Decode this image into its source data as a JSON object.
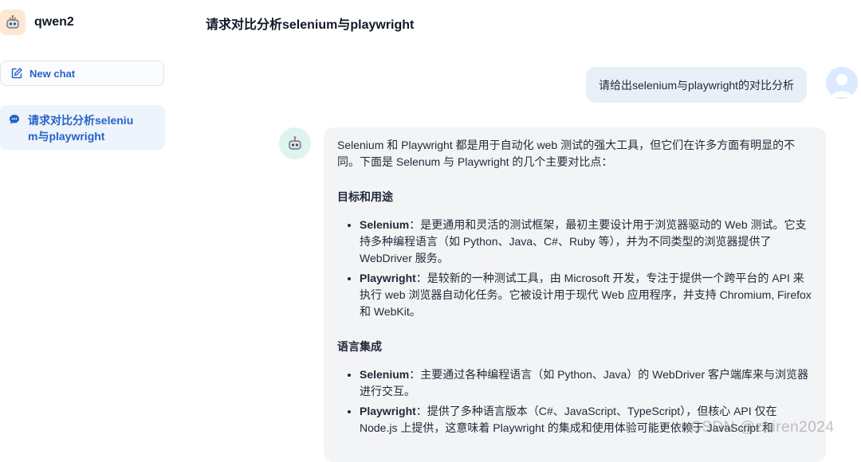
{
  "sidebar": {
    "brand_name": "qwen2",
    "new_chat_label": "New chat",
    "conversations": [
      {
        "label": "请求对比分析selenium与playwright"
      }
    ]
  },
  "header": {
    "title": "请求对比分析selenium与playwright"
  },
  "messages": {
    "user": {
      "text": "请给出selenium与playwright的对比分析"
    },
    "assistant": {
      "intro": "Selenium 和 Playwright 都是用于自动化 web 测试的强大工具，但它们在许多方面有明显的不同。下面是 Selenum 与 Playwright 的几个主要对比点：",
      "sections": [
        {
          "heading": "目标和用途",
          "items": [
            {
              "term": "Selenium",
              "text": "：是更通用和灵活的测试框架，最初主要设计用于浏览器驱动的 Web 测试。它支持多种编程语言（如 Python、Java、C#、Ruby 等），并为不同类型的浏览器提供了 WebDriver 服务。"
            },
            {
              "term": "Playwright",
              "text": "：是较新的一种测试工具，由 Microsoft 开发，专注于提供一个跨平台的 API 来执行 web 浏览器自动化任务。它被设计用于现代 Web 应用程序，并支持 Chromium, Firefox 和 WebKit。"
            }
          ]
        },
        {
          "heading": "语言集成",
          "items": [
            {
              "term": "Selenium",
              "text": "：主要通过各种编程语言（如 Python、Java）的 WebDriver 客户端库来与浏览器进行交互。"
            },
            {
              "term": "Playwright",
              "text": "：提供了多种语言版本（C#、JavaScript、TypeScript），但核心 API 仅在 Node.js 上提供，这意味着 Playwright 的集成和使用体验可能更依赖于 JavaScript 和"
            }
          ]
        }
      ]
    }
  },
  "watermark": "CSDN @zhiren2024",
  "colors": {
    "accent": "#2563c9",
    "user_bubble": "#e8eff9",
    "assistant_bubble": "#f3f4f6",
    "active_item": "#eef3fc"
  },
  "icons": {
    "brand": "robot-icon",
    "new_chat": "edit-icon",
    "conversation": "chat-bubble-icon",
    "user": "user-avatar-icon",
    "assistant": "robot-icon"
  }
}
